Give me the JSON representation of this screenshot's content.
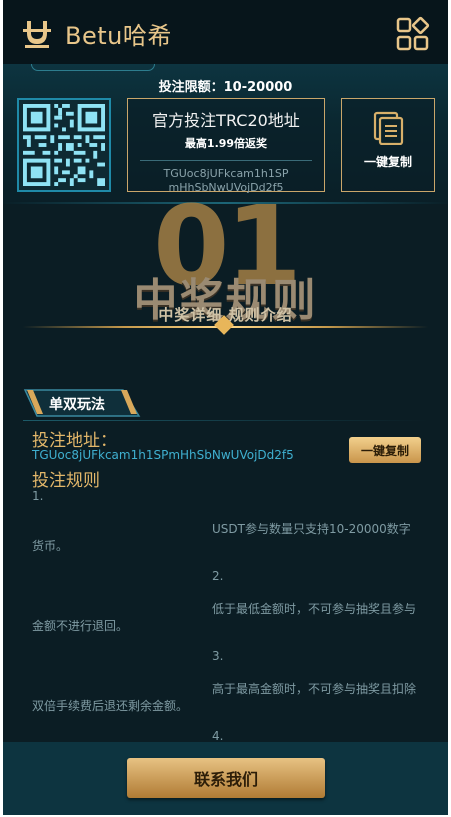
{
  "header": {
    "app_title": "Betu哈希",
    "logo_icon": "betu-logo-icon",
    "menu_icon": "grid-menu-icon"
  },
  "top_panel": {
    "limit_text": "投注限额：10-20000",
    "address_title": "官方投注TRC20地址",
    "rebate_text": "最高1.99倍返奖",
    "address_line1": "TGUoc8jUFkcam1h1SP",
    "address_line2": "mHhSbNwUVojDd2f5",
    "copy_label": "一键复制"
  },
  "banner": {
    "number": "01",
    "title": "中奖规则",
    "subtitle": "中奖详细 规则介绍"
  },
  "section": {
    "tag_label": "单双玩法",
    "address_label": "投注地址：",
    "address_value": "TGUoc8jUFkcam1h1SPmHhSbNwUVojDd2f5",
    "copy_button": "一键复制",
    "rules_label": "投注规则",
    "rules": [
      {
        "num": "1.",
        "text": "USDT参与数量只支持10-20000数字货币。"
      },
      {
        "num": "2.",
        "text": "低于最低金额时，不可参与抽奖且参与金额不进行退回。"
      },
      {
        "num": "3.",
        "text": "高于最高金额时，不可参与抽奖且扣除双倍手续费后退还剩余金额。"
      },
      {
        "num": "4.",
        "text": ""
      }
    ]
  },
  "footer": {
    "contact_button": "联系我们"
  },
  "colors": {
    "background": "#0b1d24",
    "gold": "#e3b76a",
    "cyan": "#3fb0d0",
    "panel": "#0d3440"
  }
}
